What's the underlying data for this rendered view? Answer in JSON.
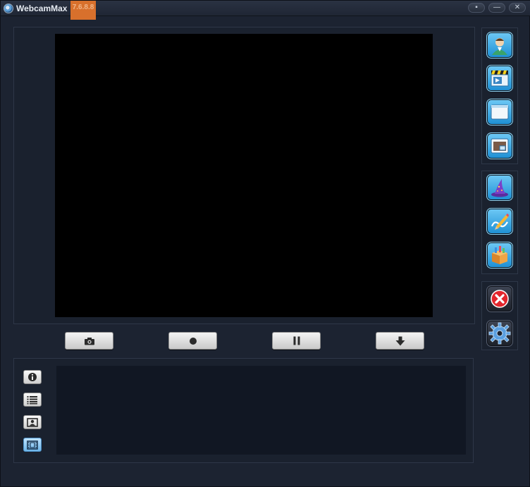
{
  "window": {
    "app_title": "WebcamMax",
    "version": "7.6.8.8",
    "title_buttons": [
      {
        "name": "mini-mode",
        "glyph": "▪"
      },
      {
        "name": "minimize",
        "glyph": "—"
      },
      {
        "name": "close",
        "glyph": "✕"
      }
    ]
  },
  "controls": [
    {
      "name": "snapshot",
      "icon": "camera-icon"
    },
    {
      "name": "record",
      "icon": "record-icon"
    },
    {
      "name": "pause",
      "icon": "pause-icon"
    },
    {
      "name": "download",
      "icon": "download-icon"
    }
  ],
  "sidebar": {
    "group1": [
      "profile-icon",
      "video-clapper-icon",
      "window-icon",
      "picture-in-picture-icon"
    ],
    "group2": [
      "wizard-hat-icon",
      "paint-pencil-icon",
      "effects-box-icon"
    ],
    "group3": [
      "close-icon",
      "settings-gear-icon"
    ]
  },
  "log_tabs": [
    {
      "name": "info",
      "icon": "info-icon",
      "active": false
    },
    {
      "name": "list",
      "icon": "list-icon",
      "active": false
    },
    {
      "name": "contact",
      "icon": "contact-card-icon",
      "active": false
    },
    {
      "name": "film",
      "icon": "film-icon",
      "active": true
    }
  ],
  "colors": {
    "background": "#1c2331",
    "accent_version": "#d8702c",
    "tile_blue": "#1d8fd4"
  }
}
